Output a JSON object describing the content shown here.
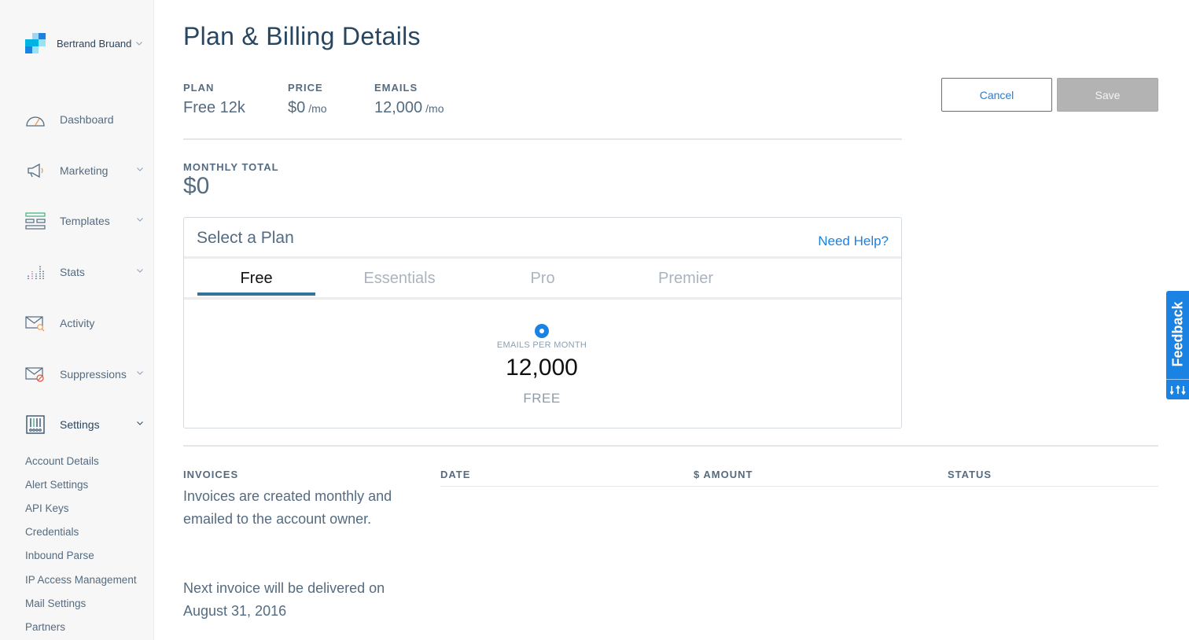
{
  "account": {
    "name": "Bertrand Bruand"
  },
  "nav": {
    "items": [
      {
        "id": "dashboard",
        "label": "Dashboard",
        "icon": "dashboard-icon",
        "has_submenu": false
      },
      {
        "id": "marketing",
        "label": "Marketing",
        "icon": "megaphone-icon",
        "has_submenu": true
      },
      {
        "id": "templates",
        "label": "Templates",
        "icon": "templates-icon",
        "has_submenu": true
      },
      {
        "id": "stats",
        "label": "Stats",
        "icon": "stats-icon",
        "has_submenu": true
      },
      {
        "id": "activity",
        "label": "Activity",
        "icon": "activity-icon",
        "has_submenu": false
      },
      {
        "id": "suppressions",
        "label": "Suppressions",
        "icon": "suppressions-icon",
        "has_submenu": true
      },
      {
        "id": "settings",
        "label": "Settings",
        "icon": "settings-icon",
        "has_submenu": true,
        "active": true
      }
    ],
    "settings_sub": [
      "Account Details",
      "Alert Settings",
      "API Keys",
      "Credentials",
      "Inbound Parse",
      "IP Access Management",
      "Mail Settings",
      "Partners"
    ]
  },
  "page": {
    "title": "Plan & Billing Details"
  },
  "summary": {
    "plan_label": "PLAN",
    "plan_value": "Free 12k",
    "price_label": "PRICE",
    "price_value": "$0",
    "price_unit": "/mo",
    "emails_label": "EMAILS",
    "emails_value": "12,000",
    "emails_unit": "/mo"
  },
  "monthly_total": {
    "label": "MONTHLY TOTAL",
    "value": "$0"
  },
  "actions": {
    "cancel": "Cancel",
    "save": "Save"
  },
  "plan_selector": {
    "title": "Select a Plan",
    "help": "Need Help?",
    "tabs": [
      "Free",
      "Essentials",
      "Pro",
      "Premier"
    ],
    "active_tab": "Free",
    "emails_per_month_label": "EMAILS PER MONTH",
    "emails_per_month_value": "12,000",
    "price_text": "FREE"
  },
  "invoices": {
    "label": "INVOICES",
    "description": "Invoices are created monthly and emailed to the account owner.",
    "next_invoice": "Next invoice will be delivered on August 31, 2016",
    "columns": [
      "DATE",
      "$ AMOUNT",
      "STATUS"
    ]
  },
  "feedback": {
    "label": "Feedback"
  },
  "colors": {
    "accent": "#1a82e2",
    "text": "#294661",
    "muted": "#546b81",
    "tab_underline": "#347299",
    "save_disabled": "#b3b3b3"
  }
}
